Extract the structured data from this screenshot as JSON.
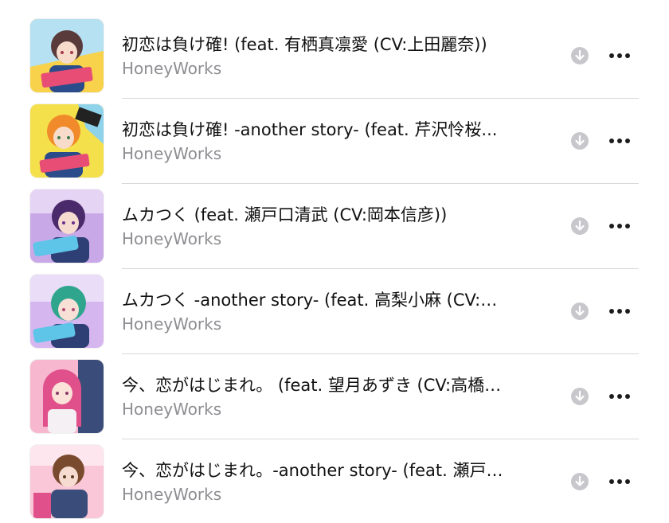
{
  "tracks": [
    {
      "title": "初恋は負け確! (feat. 有栖真凛愛 (CV:上田麗奈))",
      "artist": "HoneyWorks",
      "art_colors": [
        "#f7d24a",
        "#5a3b3b",
        "#b6e1f2"
      ],
      "icons": {
        "download": "download-circle-icon",
        "more": "more-dots-icon"
      }
    },
    {
      "title": "初恋は負け確! -another story- (feat. 芹沢怜桜...",
      "artist": "HoneyWorks",
      "art_colors": [
        "#f4e04a",
        "#f08a2a",
        "#8fd3ea"
      ],
      "icons": {
        "download": "download-circle-icon",
        "more": "more-dots-icon"
      }
    },
    {
      "title": "ムカつく (feat. 瀬戸口清武 (CV:岡本信彦))",
      "artist": "HoneyWorks",
      "art_colors": [
        "#c9a8e8",
        "#4a2a6b",
        "#5ec4e8"
      ],
      "icons": {
        "download": "download-circle-icon",
        "more": "more-dots-icon"
      }
    },
    {
      "title": "ムカつく -another story- (feat. 高梨小麻 (CV:…",
      "artist": "HoneyWorks",
      "art_colors": [
        "#d6b6ef",
        "#2fa58d",
        "#5ec4e8"
      ],
      "icons": {
        "download": "download-circle-icon",
        "more": "more-dots-icon"
      }
    },
    {
      "title": "今、恋がはじまれ。 (feat. 望月あずき (CV:高橋…",
      "artist": "HoneyWorks",
      "art_colors": [
        "#f7b8cf",
        "#e0508a",
        "#3a4d7a"
      ],
      "icons": {
        "download": "download-circle-icon",
        "more": "more-dots-icon"
      }
    },
    {
      "title": "今、恋がはじまれ。-another story- (feat. 瀬戸…",
      "artist": "HoneyWorks",
      "art_colors": [
        "#f9c7d8",
        "#7a4a2e",
        "#3a4d7a"
      ],
      "icons": {
        "download": "download-circle-icon",
        "more": "more-dots-icon"
      }
    }
  ],
  "colors": {
    "title": "#111111",
    "artist": "#8e8e93",
    "download_icon": "#c7c7cc",
    "more_icon": "#1c1c1e",
    "divider": "#d8d8dc"
  }
}
